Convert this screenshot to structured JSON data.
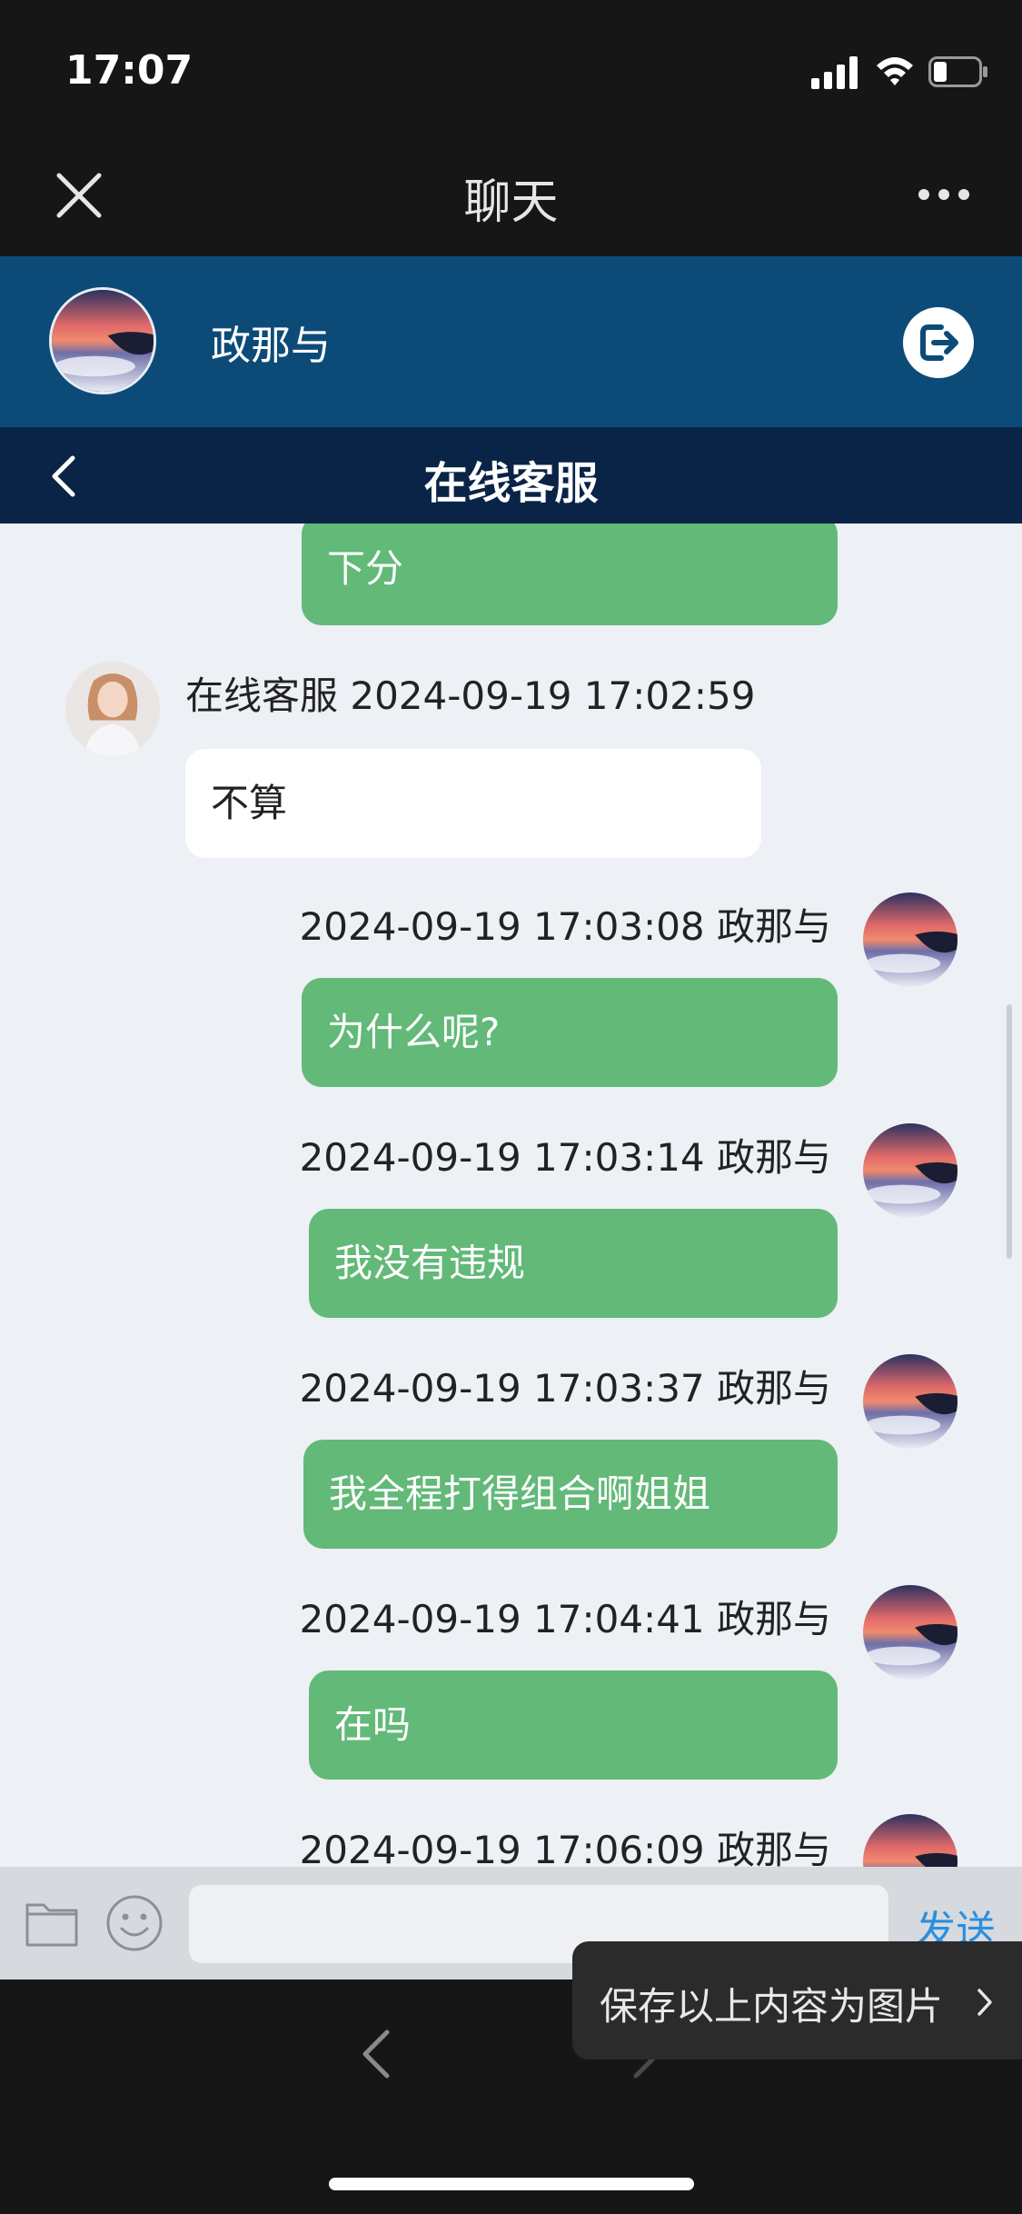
{
  "status_bar": {
    "time": "17:07"
  },
  "header": {
    "title": "聊天"
  },
  "user_bar": {
    "name": "政那与"
  },
  "service": {
    "title": "在线客服"
  },
  "messages": [
    {
      "direction": "out",
      "text": "下分"
    },
    {
      "direction": "in",
      "meta": "在线客服 2024-09-19 17:02:59",
      "text": "不算"
    },
    {
      "direction": "out",
      "meta": "2024-09-19 17:03:08 政那与",
      "text": "为什么呢?"
    },
    {
      "direction": "out",
      "meta": "2024-09-19 17:03:14 政那与",
      "text": "我没有违规"
    },
    {
      "direction": "out",
      "meta": "2024-09-19 17:03:37 政那与",
      "text": "我全程打得组合啊姐姐"
    },
    {
      "direction": "out",
      "meta": "2024-09-19 17:04:41 政那与",
      "text": "在吗"
    },
    {
      "direction": "out",
      "meta": "2024-09-19 17:06:09 政那与",
      "text": ""
    }
  ],
  "input": {
    "placeholder": "",
    "send_label": "发送"
  },
  "toast": {
    "label": "保存以上内容为图片"
  },
  "colors": {
    "outgoing_bubble": "#62b978",
    "user_bar": "#0c4b78",
    "service_bar": "#0a2447",
    "send": "#2a8fe0"
  }
}
